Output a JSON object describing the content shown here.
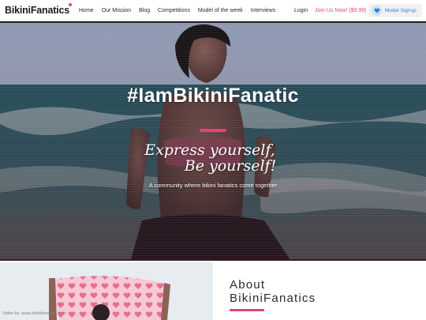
{
  "header": {
    "logo": "BikiniFanatics",
    "nav": [
      "Home",
      "Our Mission",
      "Blog",
      "Competitions",
      "Model of the week",
      "Interviews"
    ],
    "login": "Login",
    "join": "Join Us Now! ($9.99)",
    "model_signup": "Model Signup",
    "accent_color": "#e3447a",
    "model_color": "#3c7fd0"
  },
  "hero": {
    "title": "#IamBikiniFanatic",
    "script_line1": "Express yourself,",
    "script_line2": "Be yourself!",
    "tagline": "A community where bikini fanatics come together"
  },
  "about": {
    "heading_line1": "About",
    "heading_line2": "BikiniFanatics",
    "photo_watermark": "Video by: www.bikinifanatics.com"
  },
  "icons": {
    "model_signup_icon": "heart-icon"
  }
}
